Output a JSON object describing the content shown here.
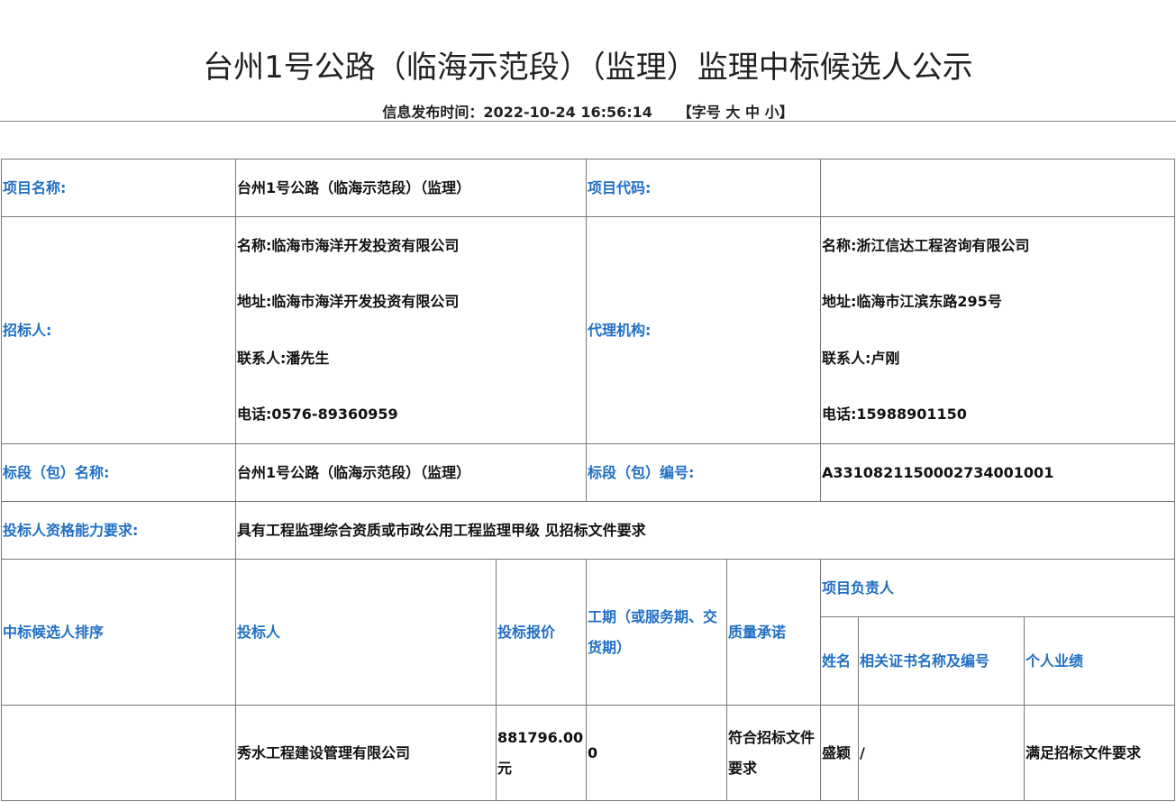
{
  "title": "台州1号公路（临海示范段）（监理）监理中标候选人公示",
  "meta": {
    "publish_label": "信息发布时间：",
    "publish_time": "2022-10-24 16:56:14",
    "font_size_open": "【字号",
    "font_large": "大",
    "font_medium": "中",
    "font_small": "小",
    "font_size_close": "】"
  },
  "project": {
    "name_label": "项目名称:",
    "name": "台州1号公路（临海示范段）（监理）",
    "code_label": "项目代码:",
    "code": ""
  },
  "tenderer": {
    "label": "招标人:",
    "name": "名称:临海市海洋开发投资有限公司",
    "address": "地址:临海市海洋开发投资有限公司",
    "contact": "联系人:潘先生",
    "phone": "电话:0576-89360959"
  },
  "agency": {
    "label": "代理机构:",
    "name": "名称:浙江信达工程咨询有限公司",
    "address": "地址:临海市江滨东路295号",
    "contact": "联系人:卢刚",
    "phone": "电话:15988901150"
  },
  "section": {
    "name_label": "标段（包）名称:",
    "name": "台州1号公路（临海示范段）（监理）",
    "code_label": "标段（包）编号:",
    "code": "A3310821150002734001001"
  },
  "qualification": {
    "label": "投标人资格能力要求:",
    "value": "具有工程监理综合资质或市政公用工程监理甲级 见招标文件要求"
  },
  "candidates_header": {
    "rank": "中标候选人排序",
    "bidder": "投标人",
    "price": "投标报价",
    "period": "工期（或服务期、交货期）",
    "quality": "质量承诺",
    "manager": "项目负责人",
    "manager_name": "姓名",
    "manager_cert": "相关证书名称及编号",
    "manager_perf": "个人业绩"
  },
  "candidates": [
    {
      "rank": "",
      "bidder": "秀水工程建设管理有限公司",
      "price": "881796.00元",
      "period": "0",
      "quality": "符合招标文件要求",
      "manager_name": "盛颖",
      "manager_cert": "/",
      "manager_perf": "满足招标文件要求"
    }
  ]
}
